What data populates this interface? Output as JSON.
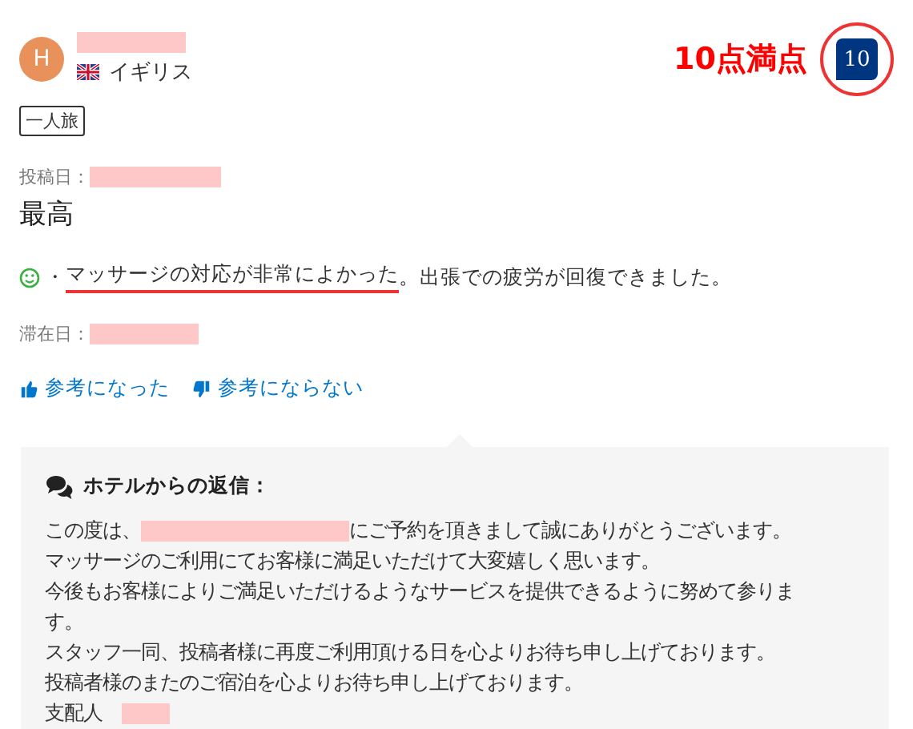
{
  "reviewer": {
    "avatar_letter": "H",
    "country": "イギリス"
  },
  "annotation": "10点満点",
  "score": "10",
  "tags": [
    "一人旅"
  ],
  "posted_label": "投稿日：",
  "title": "最高",
  "review": {
    "kind": "smiley",
    "separator": "・",
    "highlighted": "マッサージの対応が非常によかった",
    "rest": "。出張での疲労が回復できました。"
  },
  "stay_label": "滞在日：",
  "votes": [
    {
      "label": "参考になった",
      "kind": "up"
    },
    {
      "label": "参考にならない",
      "kind": "down"
    }
  ],
  "reply": {
    "heading": "ホテルからの返信：",
    "lines": [
      [
        {
          "kind": "text",
          "text": "この度は、"
        },
        {
          "kind": "redacted-long"
        },
        {
          "kind": "text",
          "text": "にご予約を頂きまして誠にありがとうございます。"
        }
      ],
      [
        {
          "kind": "text",
          "text": "マッサージのご利用にてお客様に満足いただけて大変嬉しく思います。"
        }
      ],
      [
        {
          "kind": "text",
          "text": "今後もお客様によりご満足いただけるようなサービスを提供できるように努めて参りま"
        }
      ],
      [
        {
          "kind": "text",
          "text": "す。"
        }
      ],
      [
        {
          "kind": "text",
          "text": "スタッフ一同、投稿者様に再度ご利用頂ける日を心よりお待ち申し上げております。"
        }
      ],
      [
        {
          "kind": "text",
          "text": "投稿者様のまたのご宿泊を心よりお待ち申し上げております。"
        }
      ],
      [
        {
          "kind": "text",
          "text": "支配人"
        },
        {
          "kind": "redacted-short"
        }
      ]
    ]
  }
}
